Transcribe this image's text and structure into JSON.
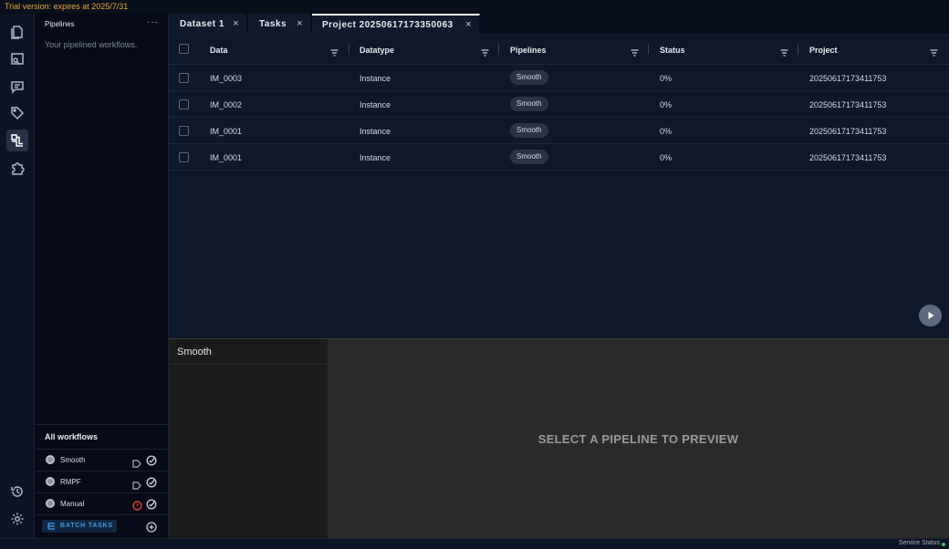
{
  "trial_banner": "Trial version: expires at 2025/7/31",
  "rail": {
    "items": [
      {
        "name": "document-icon",
        "active": false
      },
      {
        "name": "image-search-icon",
        "active": false
      },
      {
        "name": "comment-icon",
        "active": false
      },
      {
        "name": "tag-icon",
        "active": false
      },
      {
        "name": "pipeline-icon",
        "active": true
      },
      {
        "name": "puzzle-icon",
        "active": false
      }
    ],
    "bottom": [
      {
        "name": "history-icon"
      },
      {
        "name": "gear-icon"
      }
    ]
  },
  "sidebar": {
    "title": "Pipelines",
    "more": "···",
    "description": "Your pipelined workflows.",
    "workflows_title": "All workflows",
    "workflows": [
      {
        "label": "Smooth",
        "status_icon": "tag-icon"
      },
      {
        "label": "RMPF",
        "status_icon": "tag-icon"
      },
      {
        "label": "Manual",
        "status_icon": "warning-icon"
      }
    ],
    "batch_label": "BATCH TASKS"
  },
  "tabs": [
    {
      "label": "Dataset 1",
      "close": "×",
      "active": false
    },
    {
      "label": "Tasks",
      "close": "×",
      "active": false
    },
    {
      "label": "Project 20250617173350063",
      "close": "×",
      "active": true
    }
  ],
  "table": {
    "columns": [
      "Data",
      "Datatype",
      "Pipelines",
      "Status",
      "Project"
    ],
    "rows": [
      {
        "data": "IM_0003",
        "datatype": "Instance",
        "pipeline": "Smooth",
        "status": "0%",
        "project": "20250617173411753"
      },
      {
        "data": "IM_0002",
        "datatype": "Instance",
        "pipeline": "Smooth",
        "status": "0%",
        "project": "20250617173411753"
      },
      {
        "data": "IM_0001",
        "datatype": "Instance",
        "pipeline": "Smooth",
        "status": "0%",
        "project": "20250617173411753"
      },
      {
        "data": "IM_0001",
        "datatype": "Instance",
        "pipeline": "Smooth",
        "status": "0%",
        "project": "20250617173411753"
      }
    ]
  },
  "preview": {
    "pipeline_item": "Smooth",
    "message": "SELECT A PIPELINE TO PREVIEW"
  },
  "status_bar": {
    "label": "Service Status",
    "color": "#36c36b"
  }
}
